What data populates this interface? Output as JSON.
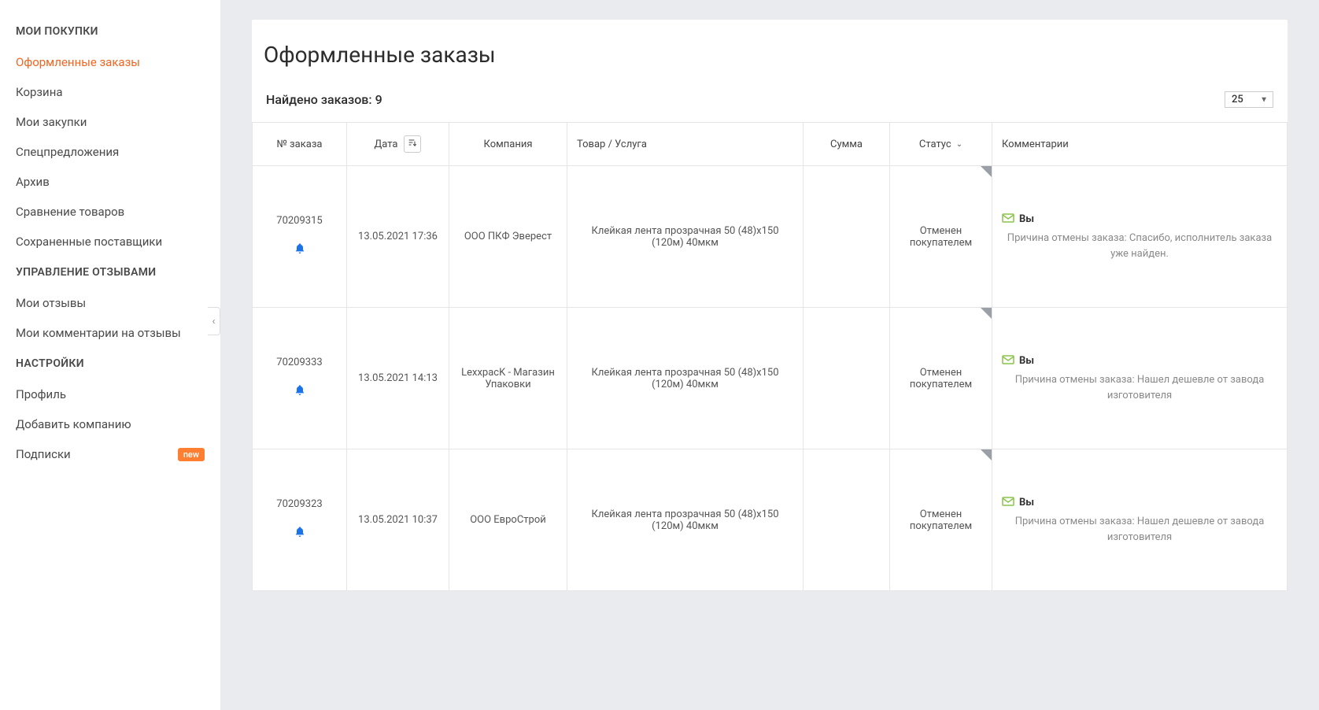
{
  "sidebar": {
    "section1_title": "МОИ ПОКУПКИ",
    "items1": [
      {
        "label": "Оформленные заказы",
        "active": true
      },
      {
        "label": "Корзина"
      },
      {
        "label": "Мои закупки"
      },
      {
        "label": "Спецпредложения"
      },
      {
        "label": "Архив"
      },
      {
        "label": "Сравнение товаров"
      },
      {
        "label": "Сохраненные поставщики"
      }
    ],
    "section2_title": "УПРАВЛЕНИЕ ОТЗЫВАМИ",
    "items2": [
      {
        "label": "Мои отзывы"
      },
      {
        "label": "Мои комментарии на отзывы"
      }
    ],
    "section3_title": "НАСТРОЙКИ",
    "items3": [
      {
        "label": "Профиль"
      },
      {
        "label": "Добавить компанию"
      },
      {
        "label": "Подписки",
        "badge": "new"
      }
    ]
  },
  "page": {
    "title": "Оформленные заказы",
    "found_label": "Найдено заказов: 9",
    "pagesize": "25"
  },
  "table": {
    "headers": {
      "order": "№ заказа",
      "date": "Дата",
      "company": "Компания",
      "product": "Товар / Услуга",
      "sum": "Сумма",
      "status": "Статус",
      "comments": "Комментарии"
    },
    "rows": [
      {
        "order_id": "70209315",
        "date": "13.05.2021 17:36",
        "company": "ООО ПКФ Эверест",
        "product": "Клейкая лента прозрачная 50 (48)х150 (120м) 40мкм",
        "sum": "",
        "status": "Отменен покупателем",
        "comment_author": "Вы",
        "comment_text": "Причина отмены заказа: Спасибо, исполнитель заказа уже найден."
      },
      {
        "order_id": "70209333",
        "date": "13.05.2021 14:13",
        "company": "LexxpacK - Магазин Упаковки",
        "product": "Клейкая лента прозрачная 50 (48)х150 (120м) 40мкм",
        "sum": "",
        "status": "Отменен покупателем",
        "comment_author": "Вы",
        "comment_text": "Причина отмены заказа: Нашел дешевле от завода изготовителя"
      },
      {
        "order_id": "70209323",
        "date": "13.05.2021 10:37",
        "company": "ООО ЕвроСтрой",
        "product": "Клейкая лента прозрачная 50 (48)х150 (120м) 40мкм",
        "sum": "",
        "status": "Отменен покупателем",
        "comment_author": "Вы",
        "comment_text": "Причина отмены заказа: Нашел дешевле от завода изготовителя"
      }
    ]
  }
}
